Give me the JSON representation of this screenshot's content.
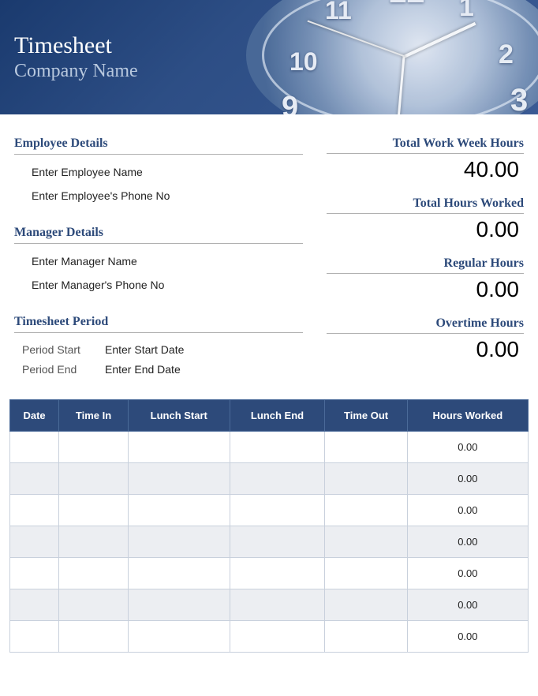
{
  "header": {
    "title": "Timesheet",
    "company": "Company Name"
  },
  "employee": {
    "heading": "Employee Details",
    "name_placeholder": "Enter Employee Name",
    "phone_placeholder": "Enter Employee's Phone No"
  },
  "manager": {
    "heading": "Manager Details",
    "name_placeholder": "Enter Manager Name",
    "phone_placeholder": "Enter Manager's Phone No"
  },
  "period": {
    "heading": "Timesheet Period",
    "start_label": "Period Start",
    "start_value": "Enter Start Date",
    "end_label": "Period End",
    "end_value": "Enter End Date"
  },
  "metrics": {
    "total_week": {
      "label": "Total Work Week Hours",
      "value": "40.00"
    },
    "total_worked": {
      "label": "Total Hours Worked",
      "value": "0.00"
    },
    "regular": {
      "label": "Regular Hours",
      "value": "0.00"
    },
    "overtime": {
      "label": "Overtime Hours",
      "value": "0.00"
    }
  },
  "table": {
    "columns": [
      "Date",
      "Time In",
      "Lunch Start",
      "Lunch End",
      "Time Out",
      "Hours Worked"
    ],
    "rows": [
      {
        "date": "",
        "time_in": "",
        "lunch_start": "",
        "lunch_end": "",
        "time_out": "",
        "hours": "0.00"
      },
      {
        "date": "",
        "time_in": "",
        "lunch_start": "",
        "lunch_end": "",
        "time_out": "",
        "hours": "0.00"
      },
      {
        "date": "",
        "time_in": "",
        "lunch_start": "",
        "lunch_end": "",
        "time_out": "",
        "hours": "0.00"
      },
      {
        "date": "",
        "time_in": "",
        "lunch_start": "",
        "lunch_end": "",
        "time_out": "",
        "hours": "0.00"
      },
      {
        "date": "",
        "time_in": "",
        "lunch_start": "",
        "lunch_end": "",
        "time_out": "",
        "hours": "0.00"
      },
      {
        "date": "",
        "time_in": "",
        "lunch_start": "",
        "lunch_end": "",
        "time_out": "",
        "hours": "0.00"
      },
      {
        "date": "",
        "time_in": "",
        "lunch_start": "",
        "lunch_end": "",
        "time_out": "",
        "hours": "0.00"
      }
    ]
  }
}
